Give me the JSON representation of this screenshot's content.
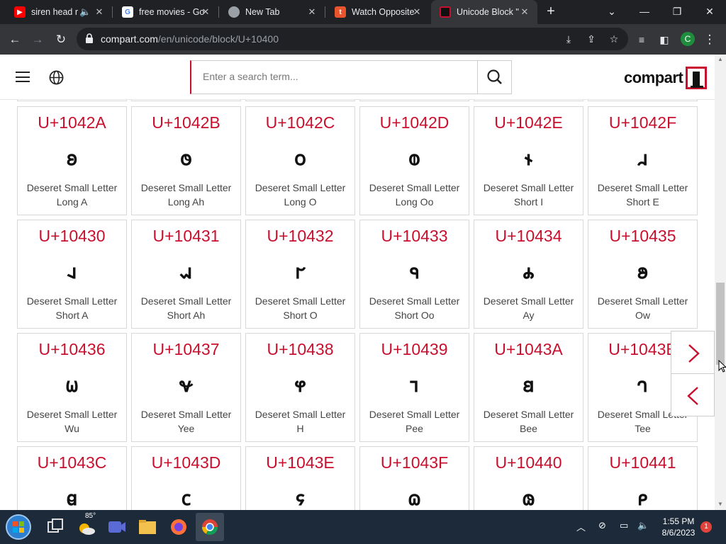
{
  "browser": {
    "tabs": [
      {
        "title": "siren head r",
        "favicon": "youtube-icon",
        "color": "#ff0000",
        "active": false
      },
      {
        "title": "free movies - Go",
        "favicon": "google-icon",
        "color": "#ffffff",
        "active": false
      },
      {
        "title": "New Tab",
        "favicon": "chrome-icon",
        "color": "#9aa0a6",
        "active": false
      },
      {
        "title": "Watch Opposite",
        "favicon": "tubi-icon",
        "color": "#e8552d",
        "active": false
      },
      {
        "title": "Unicode Block \"",
        "favicon": "compart-icon",
        "color": "#c8102e",
        "active": true
      }
    ],
    "url_host": "compart.com",
    "url_path": "/en/unicode/block/U+10400",
    "profile_initial": "C"
  },
  "site": {
    "search_placeholder": "Enter a search term...",
    "logo_text": "compart"
  },
  "cards": [
    {
      "code": "U+1042A",
      "glyph": "𐐪",
      "name1": "Deseret Small Letter",
      "name2": "Long A"
    },
    {
      "code": "U+1042B",
      "glyph": "𐐫",
      "name1": "Deseret Small Letter",
      "name2": "Long Ah"
    },
    {
      "code": "U+1042C",
      "glyph": "𐐬",
      "name1": "Deseret Small Letter",
      "name2": "Long O"
    },
    {
      "code": "U+1042D",
      "glyph": "𐐭",
      "name1": "Deseret Small Letter",
      "name2": "Long Oo"
    },
    {
      "code": "U+1042E",
      "glyph": "𐐮",
      "name1": "Deseret Small Letter",
      "name2": "Short I"
    },
    {
      "code": "U+1042F",
      "glyph": "𐐯",
      "name1": "Deseret Small Letter",
      "name2": "Short E"
    },
    {
      "code": "U+10430",
      "glyph": "𐐰",
      "name1": "Deseret Small Letter",
      "name2": "Short A"
    },
    {
      "code": "U+10431",
      "glyph": "𐐱",
      "name1": "Deseret Small Letter",
      "name2": "Short Ah"
    },
    {
      "code": "U+10432",
      "glyph": "𐐲",
      "name1": "Deseret Small Letter",
      "name2": "Short O"
    },
    {
      "code": "U+10433",
      "glyph": "𐐳",
      "name1": "Deseret Small Letter",
      "name2": "Short Oo"
    },
    {
      "code": "U+10434",
      "glyph": "𐐴",
      "name1": "Deseret Small Letter",
      "name2": "Ay"
    },
    {
      "code": "U+10435",
      "glyph": "𐐵",
      "name1": "Deseret Small Letter",
      "name2": "Ow"
    },
    {
      "code": "U+10436",
      "glyph": "𐐶",
      "name1": "Deseret Small Letter",
      "name2": "Wu"
    },
    {
      "code": "U+10437",
      "glyph": "𐐷",
      "name1": "Deseret Small Letter",
      "name2": "Yee"
    },
    {
      "code": "U+10438",
      "glyph": "𐐸",
      "name1": "Deseret Small Letter",
      "name2": "H"
    },
    {
      "code": "U+10439",
      "glyph": "𐐹",
      "name1": "Deseret Small Letter",
      "name2": "Pee"
    },
    {
      "code": "U+1043A",
      "glyph": "𐐺",
      "name1": "Deseret Small Letter",
      "name2": "Bee"
    },
    {
      "code": "U+1043B",
      "glyph": "𐐻",
      "name1": "Deseret Small Letter",
      "name2": "Tee"
    },
    {
      "code": "U+1043C",
      "glyph": "𐐼",
      "name1": "",
      "name2": ""
    },
    {
      "code": "U+1043D",
      "glyph": "𐐽",
      "name1": "",
      "name2": ""
    },
    {
      "code": "U+1043E",
      "glyph": "𐐾",
      "name1": "",
      "name2": ""
    },
    {
      "code": "U+1043F",
      "glyph": "𐐿",
      "name1": "",
      "name2": ""
    },
    {
      "code": "U+10440",
      "glyph": "𐑀",
      "name1": "",
      "name2": ""
    },
    {
      "code": "U+10441",
      "glyph": "𐑁",
      "name1": "",
      "name2": ""
    }
  ],
  "taskbar": {
    "weather_temp": "85°",
    "time": "1:55 PM",
    "date": "8/6/2023",
    "notification_count": "1"
  },
  "colors": {
    "accent": "#c8102e",
    "chrome_dark": "#202124",
    "taskbar": "#1c2a3a"
  }
}
